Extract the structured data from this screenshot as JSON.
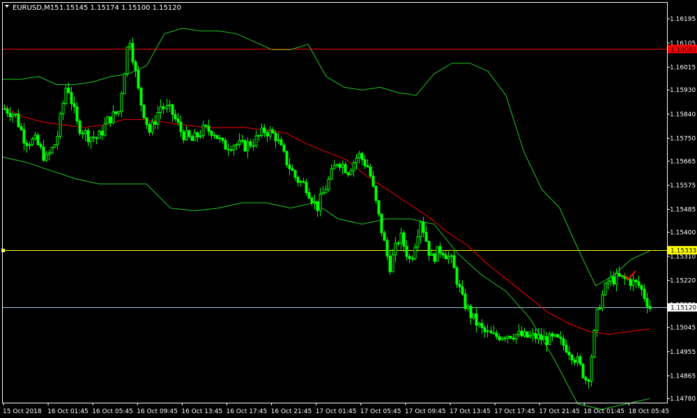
{
  "header": {
    "symbol": "EURUSD,M15",
    "ohlc": "1.15145 1.15174 1.15100 1.15120"
  },
  "colors": {
    "background": "#000000",
    "candle": "#00ff00",
    "ma": "#ff0000",
    "bands": "#22cc22",
    "h_red": "#ff0000",
    "h_yellow": "#ffff00",
    "h_current": "#a3c4d8",
    "frame": "#ffffff",
    "checkmark": "#ff0000"
  },
  "chart_data": {
    "type": "candlestick",
    "symbol": "EURUSD",
    "timeframe": "M15",
    "ylim": [
      1.14765,
      1.16255
    ],
    "y_ticks": [
      "1.16195",
      "1.16105",
      "1.16015",
      "1.15930",
      "1.15840",
      "1.15750",
      "1.15665",
      "1.15575",
      "1.15485",
      "1.15400",
      "1.15310",
      "1.15220",
      "1.15130",
      "1.15045",
      "1.14955",
      "1.14865",
      "1.14780"
    ],
    "x_ticks": [
      "15 Oct 2018",
      "16 Oct 01:45",
      "16 Oct 05:45",
      "16 Oct 09:45",
      "16 Oct 13:45",
      "16 Oct 17:45",
      "16 Oct 21:45",
      "17 Oct 01:45",
      "17 Oct 05:45",
      "17 Oct 09:45",
      "17 Oct 13:45",
      "17 Oct 17:45",
      "17 Oct 21:45",
      "18 Oct 01:45",
      "18 Oct 05:45"
    ],
    "price_labels": [
      {
        "value": 1.16083,
        "text": "1.16083",
        "color": "#ff0000"
      },
      {
        "value": 1.15333,
        "text": "1.15333",
        "color": "#ffff00"
      },
      {
        "value": 1.1512,
        "text": "1.15120",
        "color": "#ffffff"
      }
    ],
    "close_path": [
      1.1586,
      1.1584,
      1.1574,
      1.1574,
      1.1567,
      1.1574,
      1.1596,
      1.158,
      1.1576,
      1.1575,
      1.1582,
      1.1585,
      1.1614,
      1.159,
      1.1577,
      1.1587,
      1.1585,
      1.1577,
      1.1574,
      1.1578,
      1.1578,
      1.1572,
      1.1573,
      1.1572,
      1.1574,
      1.1578,
      1.1576,
      1.1567,
      1.156,
      1.1557,
      1.1549,
      1.1558,
      1.1567,
      1.1563,
      1.1569,
      1.1564,
      1.1545,
      1.1527,
      1.1539,
      1.1529,
      1.1545,
      1.153,
      1.1534,
      1.1529,
      1.1515,
      1.1508,
      1.1503,
      1.1501,
      1.1502,
      1.1502,
      1.1501,
      1.1501,
      1.15,
      1.15,
      1.1497,
      1.1492,
      1.1484,
      1.1512,
      1.1522,
      1.1523,
      1.1522,
      1.152,
      1.1512
    ],
    "ma_path": [
      1.1587,
      1.1583,
      1.1581,
      1.158,
      1.1579,
      1.158,
      1.1582,
      1.1582,
      1.1581,
      1.158,
      1.1579,
      1.1579,
      1.1579,
      1.1578,
      1.1577,
      1.1573,
      1.157,
      1.1567,
      1.1561,
      1.1556,
      1.1551,
      1.1546,
      1.154,
      1.1535,
      1.1528,
      1.1522,
      1.1516,
      1.151,
      1.1506,
      1.1503,
      1.1502,
      1.1503,
      1.1504
    ],
    "upper_band": [
      1.1597,
      1.1597,
      1.1598,
      1.1595,
      1.1595,
      1.1596,
      1.1598,
      1.1599,
      1.1602,
      1.1614,
      1.1616,
      1.1615,
      1.1615,
      1.1614,
      1.1611,
      1.1608,
      1.1608,
      1.161,
      1.1598,
      1.1594,
      1.1593,
      1.1594,
      1.1592,
      1.1591,
      1.1599,
      1.1603,
      1.1603,
      1.16,
      1.1591,
      1.157,
      1.1556,
      1.1549,
      1.1534,
      1.152,
      1.1524,
      1.153,
      1.1533
    ],
    "lower_band": [
      1.1568,
      1.1566,
      1.1563,
      1.156,
      1.1558,
      1.1558,
      1.1558,
      1.1549,
      1.1548,
      1.1549,
      1.1551,
      1.1551,
      1.1549,
      1.1551,
      1.1545,
      1.1543,
      1.1545,
      1.1545,
      1.1543,
      1.1532,
      1.1524,
      1.1518,
      1.1508,
      1.1493,
      1.1476,
      1.1474,
      1.1476,
      1.1478
    ]
  }
}
